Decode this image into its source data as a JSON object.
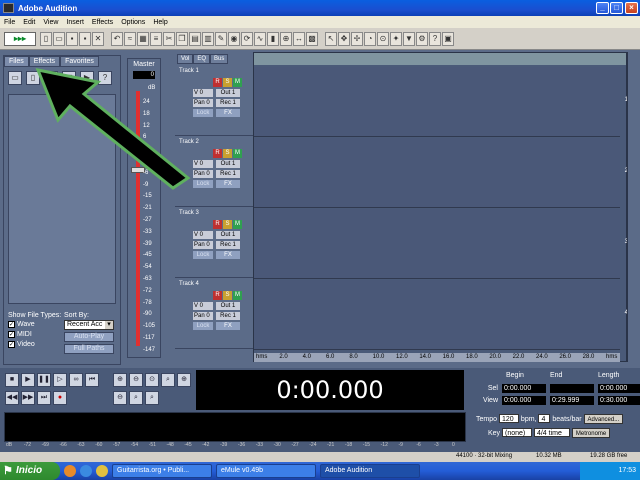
{
  "window": {
    "title": "Adobe Audition"
  },
  "menu": [
    "File",
    "Edit",
    "View",
    "Insert",
    "Effects",
    "Options",
    "Help"
  ],
  "files_panel": {
    "tabs": [
      "Files",
      "Effects",
      "Favorites"
    ],
    "show_file_types_label": "Show File Types:",
    "types": [
      {
        "label": "Wave",
        "checked": true
      },
      {
        "label": "MIDI",
        "checked": true
      },
      {
        "label": "Video",
        "checked": true
      }
    ],
    "sort_by_label": "Sort By:",
    "sort_value": "Recent Acc",
    "autoplay_label": "Auto-Play",
    "fullpaths_label": "Full Paths"
  },
  "master": {
    "label": "Master",
    "value": "0",
    "db_label": "dB",
    "ticks": [
      "24",
      "18",
      "12",
      "6",
      "0",
      "-3",
      "-6",
      "-9",
      "-15",
      "-21",
      "-27",
      "-33",
      "-39",
      "-45",
      "-54",
      "-63",
      "-72",
      "-78",
      "-90",
      "-105",
      "-117",
      "-147"
    ]
  },
  "tracks_panel": {
    "tabs": [
      "Vol",
      "EQ",
      "Bus"
    ],
    "tracks": [
      {
        "name": "Track 1",
        "vol": "V 0",
        "pan": "Pan 0",
        "out": "Out 1",
        "rec": "Rec 1",
        "lock": "Lock",
        "fx": "FX"
      },
      {
        "name": "Track 2",
        "vol": "V 0",
        "pan": "Pan 0",
        "out": "Out 1",
        "rec": "Rec 1",
        "lock": "Lock",
        "fx": "FX"
      },
      {
        "name": "Track 3",
        "vol": "V 0",
        "pan": "Pan 0",
        "out": "Out 1",
        "rec": "Rec 1",
        "lock": "Lock",
        "fx": "FX"
      },
      {
        "name": "Track 4",
        "vol": "V 0",
        "pan": "Pan 0",
        "out": "Out 1",
        "rec": "Rec 1",
        "lock": "Lock",
        "fx": "FX"
      }
    ]
  },
  "timeline": {
    "lanes": [
      "1",
      "2",
      "3",
      "4"
    ],
    "ruler": [
      "hms",
      "2.0",
      "4.0",
      "6.0",
      "8.0",
      "10.0",
      "12.0",
      "14.0",
      "16.0",
      "18.0",
      "20.0",
      "22.0",
      "24.0",
      "26.0",
      "28.0",
      "hms"
    ]
  },
  "time_display": "0:00.000",
  "selection": {
    "headers": [
      "Begin",
      "End",
      "Length"
    ],
    "sel_label": "Sel",
    "view_label": "View",
    "sel_begin": "0:00.000",
    "sel_end": "",
    "sel_length": "0:00.000",
    "view_begin": "0:00.000",
    "view_end": "0:29.999",
    "view_length": "0:30.000"
  },
  "meter_scale": [
    "dB",
    "-72",
    "-69",
    "-66",
    "-63",
    "-60",
    "-57",
    "-54",
    "-51",
    "-48",
    "-45",
    "-42",
    "-39",
    "-36",
    "-33",
    "-30",
    "-27",
    "-24",
    "-21",
    "-18",
    "-15",
    "-12",
    "-9",
    "-6",
    "-3",
    "0"
  ],
  "tempo": {
    "tempo_label": "Tempo",
    "tempo_value": "120",
    "bpm_label": "bpm,",
    "beats_value": "4",
    "beats_label": "beats/bar",
    "advanced_label": "Advanced...",
    "key_label": "Key",
    "key_value": "(none)",
    "time_sig": "4/4 time",
    "metronome_label": "Metronome"
  },
  "status": {
    "format": "44100 · 32-bit Mixing",
    "mem": "10.32 MB",
    "disk": "19.28 GB free"
  },
  "taskbar": {
    "start": "Inicio",
    "tasks": [
      {
        "label": "Guitarrista.org • Publi...",
        "active": false
      },
      {
        "label": "eMule v0.49b",
        "active": false
      },
      {
        "label": "Adobe Audition",
        "active": true
      }
    ],
    "clock": "17:53"
  }
}
